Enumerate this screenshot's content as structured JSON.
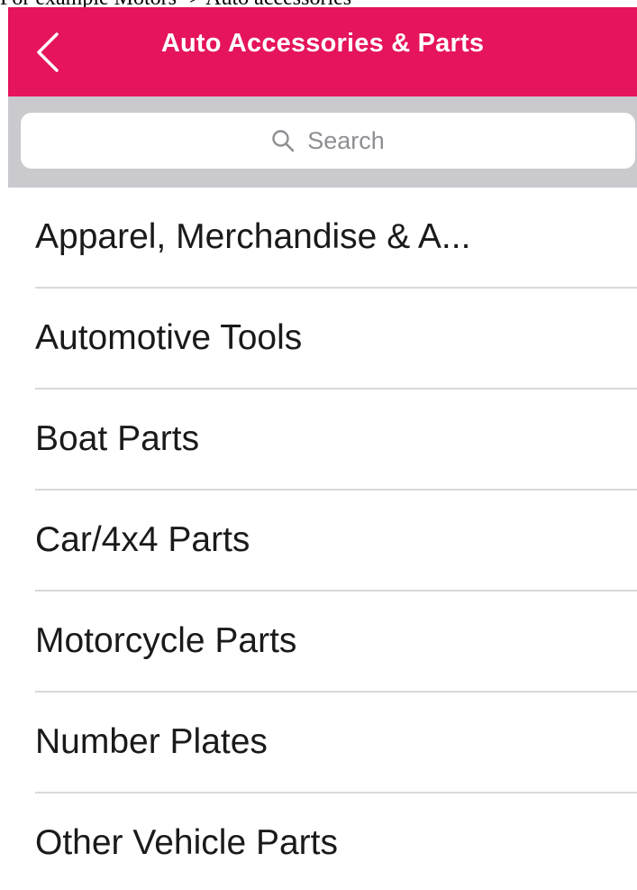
{
  "caption": "For example Motors -> Auto accessories",
  "navbar": {
    "title": "Auto Accessories & Parts",
    "back_icon": "chevron-left-icon",
    "background_color": "#e5145c"
  },
  "search": {
    "placeholder": "Search",
    "icon": "search-icon"
  },
  "categories": [
    {
      "label": "Apparel, Merchandise & A..."
    },
    {
      "label": "Automotive Tools"
    },
    {
      "label": "Boat Parts"
    },
    {
      "label": "Car/4x4 Parts"
    },
    {
      "label": "Motorcycle Parts"
    },
    {
      "label": "Number Plates"
    },
    {
      "label": "Other Vehicle Parts"
    }
  ]
}
